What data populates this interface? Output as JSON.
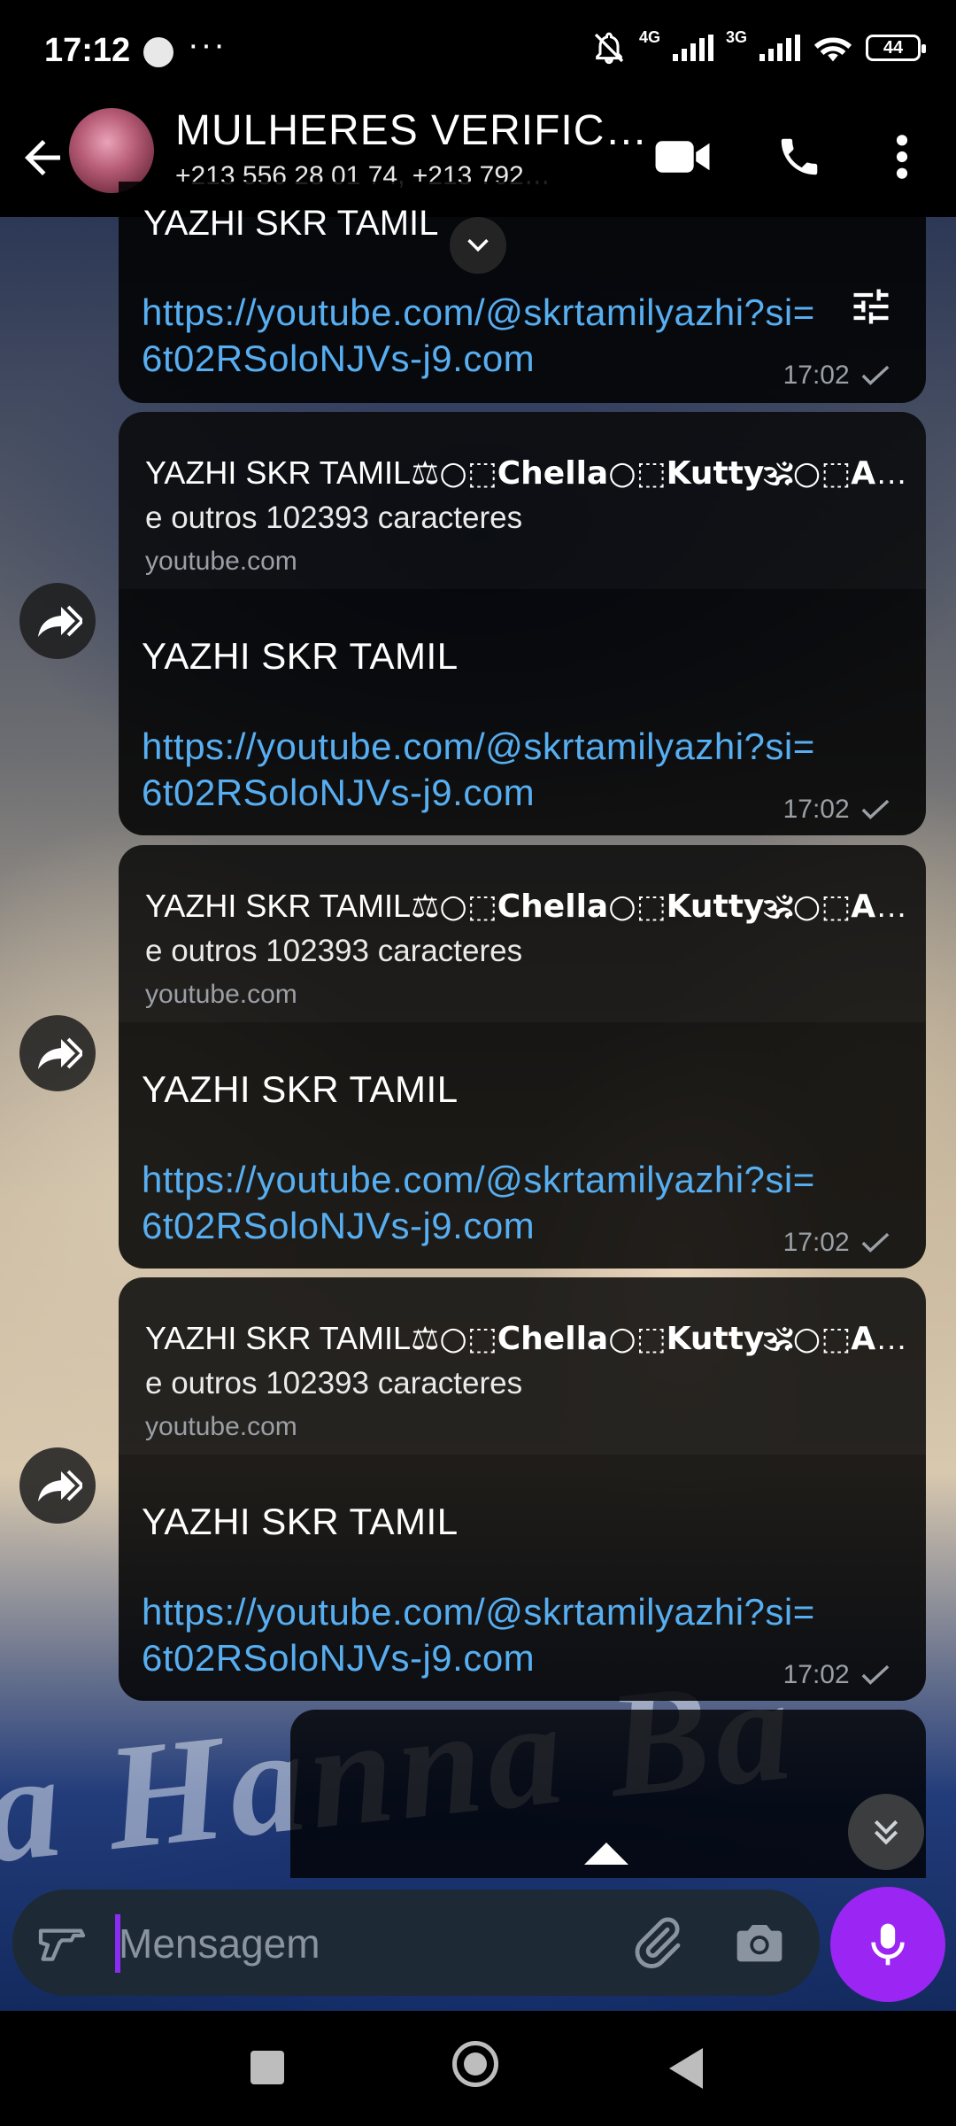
{
  "status_bar": {
    "time": "17:12",
    "more": "···",
    "net1": "4G",
    "net2": "3G",
    "battery": "44"
  },
  "header": {
    "title": "MULHERES VERIFIC…",
    "subtitle": "+213 556 28 01 74, +213 792…"
  },
  "messages": [
    {
      "partial_text": "YAZHI SKR TAMIL",
      "link": "https://youtube.com/@skrtamilyazhi?si=",
      "link2": "6t02RSoloNJVs-j9.com",
      "time": "17:02"
    },
    {
      "preview_title": "YAZHI SKR TAMIL⚖️ ⃝ Chella ⃝ Kutty🕉️ ⃝ Aju..",
      "preview_title_plain": "YAZHI SKR TAMIL",
      "preview_title_bold": "⚖○⬚Chella○⬚Kutty🕉○⬚Aju..",
      "preview_desc": "e outros 102393 caracteres",
      "preview_site": "youtube.com",
      "text": "YAZHI SKR TAMIL",
      "link": "https://youtube.com/@skrtamilyazhi?si=",
      "link2": "6t02RSoloNJVs-j9.com",
      "time": "17:02"
    },
    {
      "preview_title_plain": "YAZHI SKR TAMIL",
      "preview_title_bold": "⚖○⬚Chella○⬚Kutty🕉○⬚Aju..",
      "preview_desc": "e outros 102393 caracteres",
      "preview_site": "youtube.com",
      "text": "YAZHI SKR TAMIL",
      "link": "https://youtube.com/@skrtamilyazhi?si=",
      "link2": "6t02RSoloNJVs-j9.com",
      "time": "17:02"
    },
    {
      "preview_title_plain": "YAZHI SKR TAMIL",
      "preview_title_bold": "⚖○⬚Chella○⬚Kutty🕉○⬚Aju..",
      "preview_desc": "e outros 102393 caracteres",
      "preview_site": "youtube.com",
      "text": "YAZHI SKR TAMIL",
      "link": "https://youtube.com/@skrtamilyazhi?si=",
      "link2": "6t02RSoloNJVs-j9.com",
      "time": "17:02"
    }
  ],
  "wallpaper_text": "a Hanna Ba",
  "composer": {
    "placeholder": "Mensagem"
  },
  "colors": {
    "link": "#57aef0",
    "mic_button": "#9b25f2",
    "composer_bg": "#1e2936"
  },
  "icons": [
    "back-arrow-icon",
    "video-call-icon",
    "phone-icon",
    "more-vert-icon",
    "chevron-down-icon",
    "filter-icon",
    "forward-icon",
    "double-chevron-down-icon",
    "gif-icon",
    "attach-icon",
    "camera-icon",
    "mic-icon",
    "nav-square-icon",
    "nav-home-icon",
    "nav-back-icon"
  ]
}
